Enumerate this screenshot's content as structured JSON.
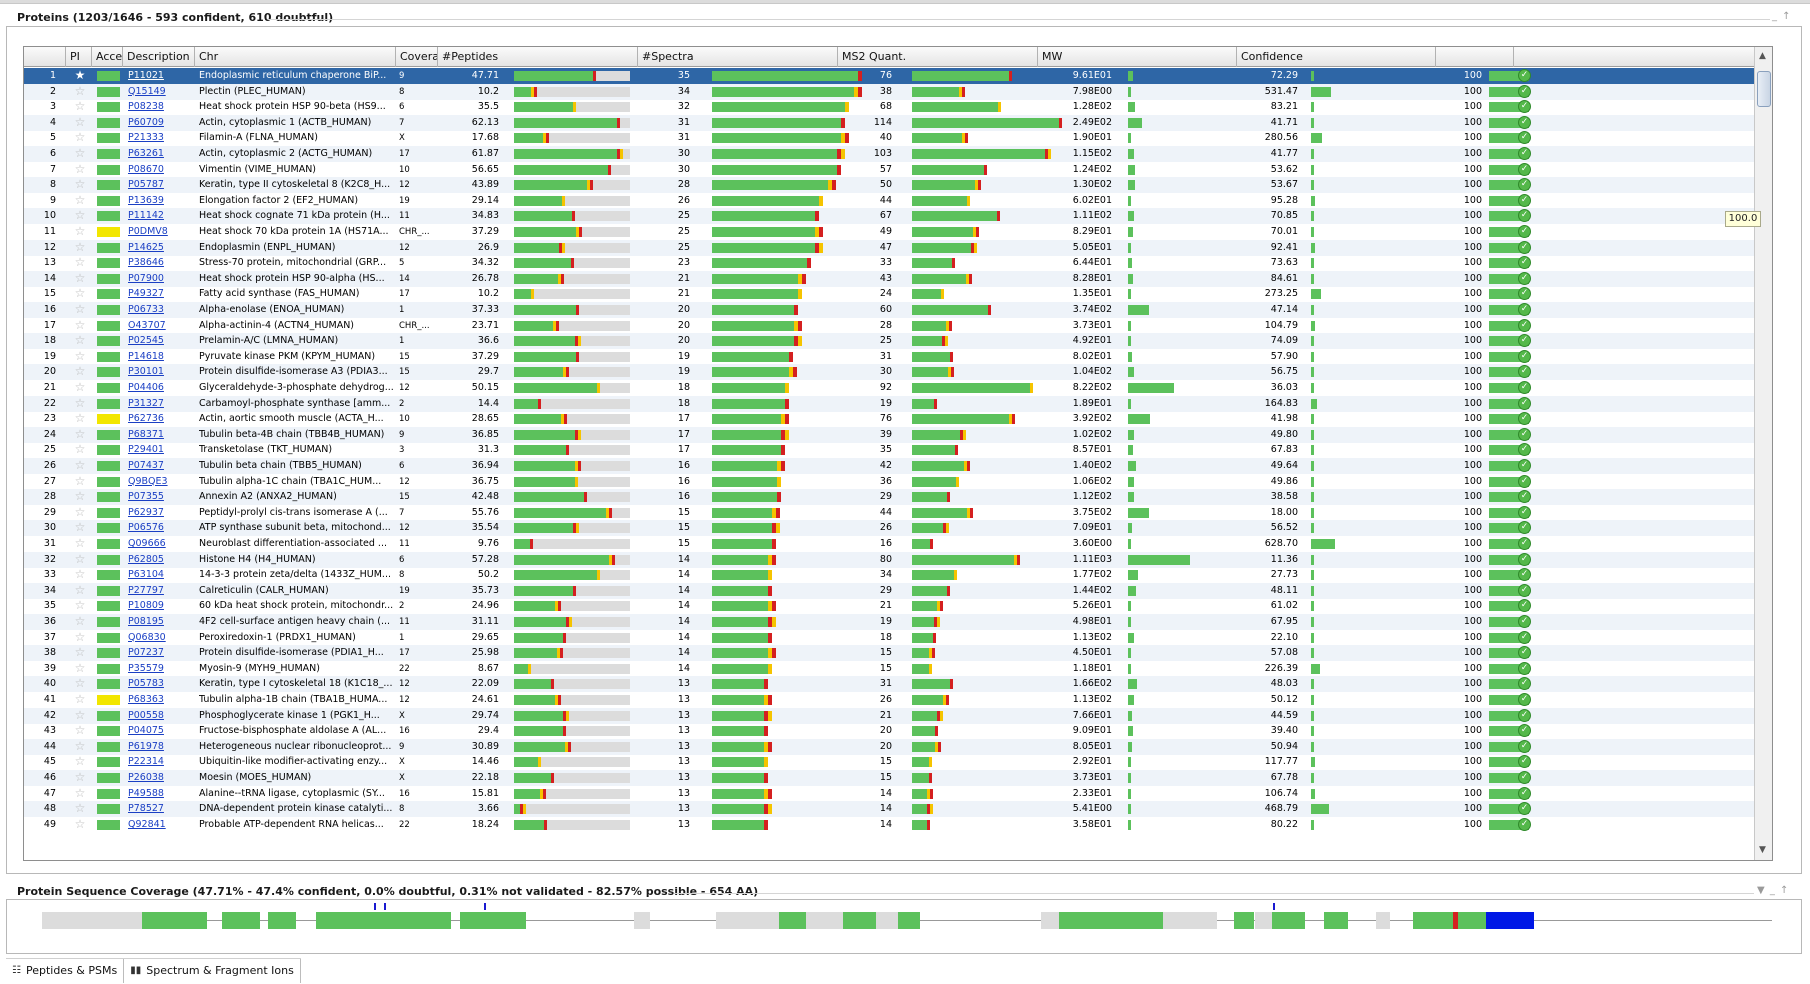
{
  "proteins_panel": {
    "title": "Proteins (1203/1646 - 593 confident, 610 doubtful)",
    "controls": "_ ↑"
  },
  "columns": [
    "",
    "PI",
    "Accession",
    "Description",
    "Chr",
    "Coverage",
    "#Peptides",
    "#Spectra",
    "MS2 Quant.",
    "MW",
    "Confidence",
    ""
  ],
  "rows": [
    {
      "n": "1",
      "pi": "green",
      "acc": "P11021",
      "desc": "Endoplasmic reticulum chaperone BiP...",
      "chr": "9",
      "cov": 47.71,
      "pep": 35,
      "spec": 76,
      "ms2": "9.61E01",
      "mw": "72.29",
      "conf": "100",
      "selected": true
    },
    {
      "n": "2",
      "pi": "green",
      "acc": "Q15149",
      "desc": "Plectin (PLEC_HUMAN)",
      "chr": "8",
      "cov": 10.2,
      "pep": 34,
      "spec": 38,
      "ms2": "7.98E00",
      "mw": "531.47",
      "conf": "100"
    },
    {
      "n": "3",
      "pi": "green",
      "acc": "P08238",
      "desc": "Heat shock protein HSP 90-beta (HS9...",
      "chr": "6",
      "cov": 35.5,
      "pep": 32,
      "spec": 68,
      "ms2": "1.28E02",
      "mw": "83.21",
      "conf": "100"
    },
    {
      "n": "4",
      "pi": "green",
      "acc": "P60709",
      "desc": "Actin, cytoplasmic 1 (ACTB_HUMAN)",
      "chr": "7",
      "cov": 62.13,
      "pep": 31,
      "spec": 114,
      "ms2": "2.49E02",
      "mw": "41.71",
      "conf": "100"
    },
    {
      "n": "5",
      "pi": "green",
      "acc": "P21333",
      "desc": "Filamin-A (FLNA_HUMAN)",
      "chr": "X",
      "cov": 17.68,
      "pep": 31,
      "spec": 40,
      "ms2": "1.90E01",
      "mw": "280.56",
      "conf": "100"
    },
    {
      "n": "6",
      "pi": "green",
      "acc": "P63261",
      "desc": "Actin, cytoplasmic 2 (ACTG_HUMAN)",
      "chr": "17",
      "cov": 61.87,
      "pep": 30,
      "spec": 103,
      "ms2": "1.15E02",
      "mw": "41.77",
      "conf": "100"
    },
    {
      "n": "7",
      "pi": "green",
      "acc": "P08670",
      "desc": "Vimentin (VIME_HUMAN)",
      "chr": "10",
      "cov": 56.65,
      "pep": 30,
      "spec": 57,
      "ms2": "1.24E02",
      "mw": "53.62",
      "conf": "100"
    },
    {
      "n": "8",
      "pi": "green",
      "acc": "P05787",
      "desc": "Keratin, type II cytoskeletal 8 (K2C8_H...",
      "chr": "12",
      "cov": 43.89,
      "pep": 28,
      "spec": 50,
      "ms2": "1.30E02",
      "mw": "53.67",
      "conf": "100"
    },
    {
      "n": "9",
      "pi": "green",
      "acc": "P13639",
      "desc": "Elongation factor 2 (EF2_HUMAN)",
      "chr": "19",
      "cov": 29.14,
      "pep": 26,
      "spec": 44,
      "ms2": "6.02E01",
      "mw": "95.28",
      "conf": "100"
    },
    {
      "n": "10",
      "pi": "green",
      "acc": "P11142",
      "desc": "Heat shock cognate 71 kDa protein (H...",
      "chr": "11",
      "cov": 34.83,
      "pep": 25,
      "spec": 67,
      "ms2": "1.11E02",
      "mw": "70.85",
      "conf": "100"
    },
    {
      "n": "11",
      "pi": "yellow",
      "acc": "P0DMV8",
      "desc": "Heat shock 70 kDa protein 1A (HS71A...",
      "chr": "CHR_...",
      "cov": 37.29,
      "pep": 25,
      "spec": 49,
      "ms2": "8.29E01",
      "mw": "70.01",
      "conf": "100"
    },
    {
      "n": "12",
      "pi": "green",
      "acc": "P14625",
      "desc": "Endoplasmin (ENPL_HUMAN)",
      "chr": "12",
      "cov": 26.9,
      "pep": 25,
      "spec": 47,
      "ms2": "5.05E01",
      "mw": "92.41",
      "conf": "100"
    },
    {
      "n": "13",
      "pi": "green",
      "acc": "P38646",
      "desc": "Stress-70 protein, mitochondrial (GRP...",
      "chr": "5",
      "cov": 34.32,
      "pep": 23,
      "spec": 33,
      "ms2": "6.44E01",
      "mw": "73.63",
      "conf": "100"
    },
    {
      "n": "14",
      "pi": "green",
      "acc": "P07900",
      "desc": "Heat shock protein HSP 90-alpha (HS...",
      "chr": "14",
      "cov": 26.78,
      "pep": 21,
      "spec": 43,
      "ms2": "8.28E01",
      "mw": "84.61",
      "conf": "100"
    },
    {
      "n": "15",
      "pi": "green",
      "acc": "P49327",
      "desc": "Fatty acid synthase (FAS_HUMAN)",
      "chr": "17",
      "cov": 10.2,
      "pep": 21,
      "spec": 24,
      "ms2": "1.35E01",
      "mw": "273.25",
      "conf": "100"
    },
    {
      "n": "16",
      "pi": "green",
      "acc": "P06733",
      "desc": "Alpha-enolase (ENOA_HUMAN)",
      "chr": "1",
      "cov": 37.33,
      "pep": 20,
      "spec": 60,
      "ms2": "3.74E02",
      "mw": "47.14",
      "conf": "100"
    },
    {
      "n": "17",
      "pi": "green",
      "acc": "O43707",
      "desc": "Alpha-actinin-4 (ACTN4_HUMAN)",
      "chr": "CHR_...",
      "cov": 23.71,
      "pep": 20,
      "spec": 28,
      "ms2": "3.73E01",
      "mw": "104.79",
      "conf": "100"
    },
    {
      "n": "18",
      "pi": "green",
      "acc": "P02545",
      "desc": "Prelamin-A/C (LMNA_HUMAN)",
      "chr": "1",
      "cov": 36.6,
      "pep": 20,
      "spec": 25,
      "ms2": "4.92E01",
      "mw": "74.09",
      "conf": "100"
    },
    {
      "n": "19",
      "pi": "green",
      "acc": "P14618",
      "desc": "Pyruvate kinase PKM (KPYM_HUMAN)",
      "chr": "15",
      "cov": 37.29,
      "pep": 19,
      "spec": 31,
      "ms2": "8.02E01",
      "mw": "57.90",
      "conf": "100"
    },
    {
      "n": "20",
      "pi": "green",
      "acc": "P30101",
      "desc": "Protein disulfide-isomerase A3 (PDIA3...",
      "chr": "15",
      "cov": 29.7,
      "pep": 19,
      "spec": 30,
      "ms2": "1.04E02",
      "mw": "56.75",
      "conf": "100"
    },
    {
      "n": "21",
      "pi": "green",
      "acc": "P04406",
      "desc": "Glyceraldehyde-3-phosphate dehydrog...",
      "chr": "12",
      "cov": 50.15,
      "pep": 18,
      "spec": 92,
      "ms2": "8.22E02",
      "mw": "36.03",
      "conf": "100"
    },
    {
      "n": "22",
      "pi": "green",
      "acc": "P31327",
      "desc": "Carbamoyl-phosphate synthase [amm...",
      "chr": "2",
      "cov": 14.4,
      "pep": 18,
      "spec": 19,
      "ms2": "1.89E01",
      "mw": "164.83",
      "conf": "100"
    },
    {
      "n": "23",
      "pi": "yellow",
      "acc": "P62736",
      "desc": "Actin, aortic smooth muscle (ACTA_H...",
      "chr": "10",
      "cov": 28.65,
      "pep": 17,
      "spec": 76,
      "ms2": "3.92E02",
      "mw": "41.98",
      "conf": "100"
    },
    {
      "n": "24",
      "pi": "green",
      "acc": "P68371",
      "desc": "Tubulin beta-4B chain (TBB4B_HUMAN)",
      "chr": "9",
      "cov": 36.85,
      "pep": 17,
      "spec": 39,
      "ms2": "1.02E02",
      "mw": "49.80",
      "conf": "100"
    },
    {
      "n": "25",
      "pi": "green",
      "acc": "P29401",
      "desc": "Transketolase (TKT_HUMAN)",
      "chr": "3",
      "cov": 31.3,
      "pep": 17,
      "spec": 35,
      "ms2": "8.57E01",
      "mw": "67.83",
      "conf": "100"
    },
    {
      "n": "26",
      "pi": "green",
      "acc": "P07437",
      "desc": "Tubulin beta chain (TBB5_HUMAN)",
      "chr": "6",
      "cov": 36.94,
      "pep": 16,
      "spec": 42,
      "ms2": "1.40E02",
      "mw": "49.64",
      "conf": "100"
    },
    {
      "n": "27",
      "pi": "green",
      "acc": "Q9BQE3",
      "desc": "Tubulin alpha-1C chain (TBA1C_HUM...",
      "chr": "12",
      "cov": 36.75,
      "pep": 16,
      "spec": 36,
      "ms2": "1.06E02",
      "mw": "49.86",
      "conf": "100"
    },
    {
      "n": "28",
      "pi": "green",
      "acc": "P07355",
      "desc": "Annexin A2 (ANXA2_HUMAN)",
      "chr": "15",
      "cov": 42.48,
      "pep": 16,
      "spec": 29,
      "ms2": "1.12E02",
      "mw": "38.58",
      "conf": "100"
    },
    {
      "n": "29",
      "pi": "green",
      "acc": "P62937",
      "desc": "Peptidyl-prolyl cis-trans isomerase A (...",
      "chr": "7",
      "cov": 55.76,
      "pep": 15,
      "spec": 44,
      "ms2": "3.75E02",
      "mw": "18.00",
      "conf": "100"
    },
    {
      "n": "30",
      "pi": "green",
      "acc": "P06576",
      "desc": "ATP synthase subunit beta, mitochond...",
      "chr": "12",
      "cov": 35.54,
      "pep": 15,
      "spec": 26,
      "ms2": "7.09E01",
      "mw": "56.52",
      "conf": "100"
    },
    {
      "n": "31",
      "pi": "green",
      "acc": "Q09666",
      "desc": "Neuroblast differentiation-associated ...",
      "chr": "11",
      "cov": 9.76,
      "pep": 15,
      "spec": 16,
      "ms2": "3.60E00",
      "mw": "628.70",
      "conf": "100"
    },
    {
      "n": "32",
      "pi": "green",
      "acc": "P62805",
      "desc": "Histone H4 (H4_HUMAN)",
      "chr": "6",
      "cov": 57.28,
      "pep": 14,
      "spec": 80,
      "ms2": "1.11E03",
      "mw": "11.36",
      "conf": "100"
    },
    {
      "n": "33",
      "pi": "green",
      "acc": "P63104",
      "desc": "14-3-3 protein zeta/delta (1433Z_HUM...",
      "chr": "8",
      "cov": 50.2,
      "pep": 14,
      "spec": 34,
      "ms2": "1.77E02",
      "mw": "27.73",
      "conf": "100"
    },
    {
      "n": "34",
      "pi": "green",
      "acc": "P27797",
      "desc": "Calreticulin (CALR_HUMAN)",
      "chr": "19",
      "cov": 35.73,
      "pep": 14,
      "spec": 29,
      "ms2": "1.44E02",
      "mw": "48.11",
      "conf": "100"
    },
    {
      "n": "35",
      "pi": "green",
      "acc": "P10809",
      "desc": "60 kDa heat shock protein, mitochondr...",
      "chr": "2",
      "cov": 24.96,
      "pep": 14,
      "spec": 21,
      "ms2": "5.26E01",
      "mw": "61.02",
      "conf": "100"
    },
    {
      "n": "36",
      "pi": "green",
      "acc": "P08195",
      "desc": "4F2 cell-surface antigen heavy chain (...",
      "chr": "11",
      "cov": 31.11,
      "pep": 14,
      "spec": 19,
      "ms2": "4.98E01",
      "mw": "67.95",
      "conf": "100"
    },
    {
      "n": "37",
      "pi": "green",
      "acc": "Q06830",
      "desc": "Peroxiredoxin-1 (PRDX1_HUMAN)",
      "chr": "1",
      "cov": 29.65,
      "pep": 14,
      "spec": 18,
      "ms2": "1.13E02",
      "mw": "22.10",
      "conf": "100"
    },
    {
      "n": "38",
      "pi": "green",
      "acc": "P07237",
      "desc": "Protein disulfide-isomerase (PDIA1_H...",
      "chr": "17",
      "cov": 25.98,
      "pep": 14,
      "spec": 15,
      "ms2": "4.50E01",
      "mw": "57.08",
      "conf": "100"
    },
    {
      "n": "39",
      "pi": "green",
      "acc": "P35579",
      "desc": "Myosin-9 (MYH9_HUMAN)",
      "chr": "22",
      "cov": 8.67,
      "pep": 14,
      "spec": 15,
      "ms2": "1.18E01",
      "mw": "226.39",
      "conf": "100"
    },
    {
      "n": "40",
      "pi": "green",
      "acc": "P05783",
      "desc": "Keratin, type I cytoskeletal 18 (K1C18_...",
      "chr": "12",
      "cov": 22.09,
      "pep": 13,
      "spec": 31,
      "ms2": "1.66E02",
      "mw": "48.03",
      "conf": "100"
    },
    {
      "n": "41",
      "pi": "yellow",
      "acc": "P68363",
      "desc": "Tubulin alpha-1B chain (TBA1B_HUMA...",
      "chr": "12",
      "cov": 24.61,
      "pep": 13,
      "spec": 26,
      "ms2": "1.13E02",
      "mw": "50.12",
      "conf": "100"
    },
    {
      "n": "42",
      "pi": "green",
      "acc": "P00558",
      "desc": "Phosphoglycerate kinase 1 (PGK1_H...",
      "chr": "X",
      "cov": 29.74,
      "pep": 13,
      "spec": 21,
      "ms2": "7.66E01",
      "mw": "44.59",
      "conf": "100"
    },
    {
      "n": "43",
      "pi": "green",
      "acc": "P04075",
      "desc": "Fructose-bisphosphate aldolase A (AL...",
      "chr": "16",
      "cov": 29.4,
      "pep": 13,
      "spec": 20,
      "ms2": "9.09E01",
      "mw": "39.40",
      "conf": "100"
    },
    {
      "n": "44",
      "pi": "green",
      "acc": "P61978",
      "desc": "Heterogeneous nuclear ribonucleoprot...",
      "chr": "9",
      "cov": 30.89,
      "pep": 13,
      "spec": 20,
      "ms2": "8.05E01",
      "mw": "50.94",
      "conf": "100"
    },
    {
      "n": "45",
      "pi": "green",
      "acc": "P22314",
      "desc": "Ubiquitin-like modifier-activating enzy...",
      "chr": "X",
      "cov": 14.46,
      "pep": 13,
      "spec": 15,
      "ms2": "2.92E01",
      "mw": "117.77",
      "conf": "100"
    },
    {
      "n": "46",
      "pi": "green",
      "acc": "P26038",
      "desc": "Moesin (MOES_HUMAN)",
      "chr": "X",
      "cov": 22.18,
      "pep": 13,
      "spec": 15,
      "ms2": "3.73E01",
      "mw": "67.78",
      "conf": "100"
    },
    {
      "n": "47",
      "pi": "green",
      "acc": "P49588",
      "desc": "Alanine--tRNA ligase, cytoplasmic (SY...",
      "chr": "16",
      "cov": 15.81,
      "pep": 13,
      "spec": 14,
      "ms2": "2.33E01",
      "mw": "106.74",
      "conf": "100"
    },
    {
      "n": "48",
      "pi": "green",
      "acc": "P78527",
      "desc": "DNA-dependent protein kinase catalyti...",
      "chr": "8",
      "cov": 3.66,
      "pep": 13,
      "spec": 14,
      "ms2": "5.41E00",
      "mw": "468.79",
      "conf": "100"
    },
    {
      "n": "49",
      "pi": "green",
      "acc": "Q92841",
      "desc": "Probable ATP-dependent RNA helicas...",
      "chr": "22",
      "cov": 18.24,
      "pep": 13,
      "spec": 14,
      "ms2": "3.58E01",
      "mw": "80.22",
      "conf": "100"
    }
  ],
  "tooltip": "100.0",
  "coverage_panel": {
    "title": "Protein Sequence Coverage (47.71% - 47.4% confident, 0.0% doubtful, 0.31% not validated - 82.57% possible - 654 AA)",
    "controls": "▼ _ ↑"
  },
  "bottom_tabs": [
    {
      "label": "Peptides & PSMs",
      "icon": "table-icon"
    },
    {
      "label": "Spectrum & Fragment Ions",
      "icon": "bar-chart-icon"
    }
  ],
  "colors": {
    "green": "#5cc15c",
    "yellow": "#f2e600",
    "orange": "#f5c400",
    "red": "#d42020",
    "grey": "#dcdcdc",
    "blue": "#0018e6",
    "selected": "#2e66a6"
  }
}
